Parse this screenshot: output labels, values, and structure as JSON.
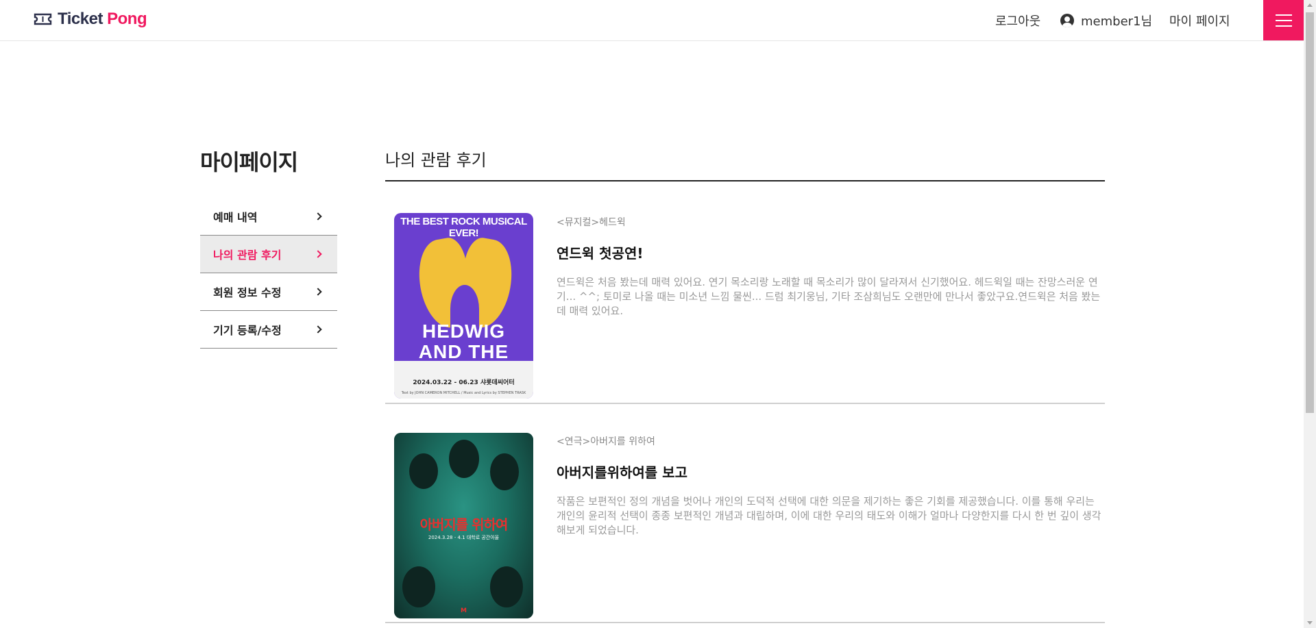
{
  "header": {
    "brand_part1": "Ticket",
    "brand_part2": "Pong",
    "logout": "로그아웃",
    "user": "member1님",
    "mypage": "마이 페이지"
  },
  "colors": {
    "accent": "#f0195f",
    "brand_dark": "#2b2f4a"
  },
  "sidebar": {
    "title": "마이페이지",
    "items": [
      {
        "label": "예매 내역"
      },
      {
        "label": "나의 관람 후기"
      },
      {
        "label": "회원 정보 수정"
      },
      {
        "label": "기기 등록/수정"
      }
    ]
  },
  "main": {
    "title": "나의 관람 후기",
    "reviews": [
      {
        "category": "<뮤지컬>헤드윅",
        "title": "연드윅 첫공연!",
        "body": "연드윅은 처음 봤는데 매력 있어요. 연기 목소리랑 노래할 때 목소리가 많이 달라져서 신기했어요. 헤드윅일 때는 잔망스러운 연기... ^^; 토미로 나올 때는 미소년 느낌 물씬... 드럼 최기웅님, 기타 조삼희님도 오랜만에 만나서 좋았구요.연드윅은 처음 봤는데 매력 있어요.",
        "poster": {
          "top_text": "THE BEST ROCK MUSICAL EVER!",
          "name": "HEDWIG AND THE ANGRY INCH",
          "date": "2024.03.22 - 06.23  샤롯데씨어터",
          "credit": "Text by JOHN CAMERON MITCHELL / Music and Lyrics by STEPHEN TRASK"
        }
      },
      {
        "category": "<연극>아버지를 위하여",
        "title": "아버지를위하여를 보고",
        "body": "작품은 보편적인 정의 개념을 벗어나 개인의 도덕적 선택에 대한 의문을 제기하는 좋은 기회를 제공했습니다. 이를 통해 우리는 개인의 윤리적 선택이 종종 보편적인 개념과 대립하며, 이에 대한 우리의 태도와 이해가 얼마나 다양한지를 다시 한 번 깊이 생각해보게 되었습니다.",
        "poster": {
          "headline": "아버지를 위하여",
          "sub": "2024.3.28 - 4.1 대학로 공간아울",
          "mark": "M"
        }
      }
    ]
  }
}
